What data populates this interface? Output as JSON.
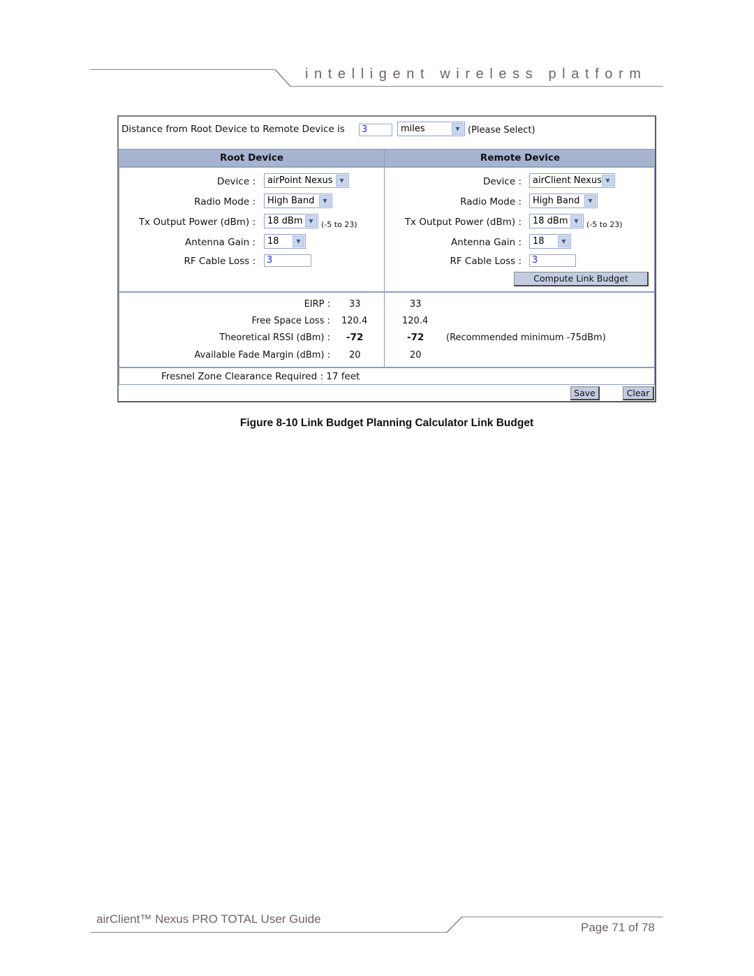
{
  "header": {
    "tagline": "intelligent wireless platform"
  },
  "calculator": {
    "distance": {
      "label": "Distance from Root Device to Remote Device is",
      "value": "3",
      "unit_selected": "miles",
      "unit_hint": "(Please Select)"
    },
    "columns": {
      "root_header": "Root Device",
      "remote_header": "Remote Device"
    },
    "field_labels": {
      "device": "Device :",
      "radio_mode": "Radio Mode :",
      "tx_power": "Tx Output Power (dBm) :",
      "antenna_gain": "Antenna Gain :",
      "rf_cable_loss": "RF Cable Loss :"
    },
    "tx_range_hint": "(-5 to 23)",
    "root": {
      "device": "airPoint Nexus",
      "radio_mode": "High Band",
      "tx_power": "18 dBm",
      "antenna_gain": "18",
      "rf_cable_loss": "3"
    },
    "remote": {
      "device": "airClient Nexus",
      "radio_mode": "High Band",
      "tx_power": "18 dBm",
      "antenna_gain": "18",
      "rf_cable_loss": "3"
    },
    "compute_button": "Compute Link Budget",
    "results": {
      "labels": {
        "eirp": "EIRP :",
        "free_space_loss": "Free Space Loss :",
        "rssi": "Theoretical RSSI (dBm) :",
        "fade_margin": "Available Fade Margin (dBm) :"
      },
      "root": {
        "eirp": "33",
        "free_space_loss": "120.4",
        "rssi": "-72",
        "fade_margin": "20"
      },
      "remote": {
        "eirp": "33",
        "free_space_loss": "120.4",
        "rssi": "-72",
        "fade_margin": "20"
      },
      "rssi_note": "(Recommended minimum -75dBm)"
    },
    "fresnel": "Fresnel Zone Clearance Required : 17 feet",
    "save_button": "Save",
    "clear_button": "Clear"
  },
  "caption": "Figure 8-10 Link Budget Planning Calculator Link Budget",
  "footer": {
    "title": "airClient™ Nexus PRO TOTAL User Guide",
    "page": "Page 71 of 78"
  }
}
